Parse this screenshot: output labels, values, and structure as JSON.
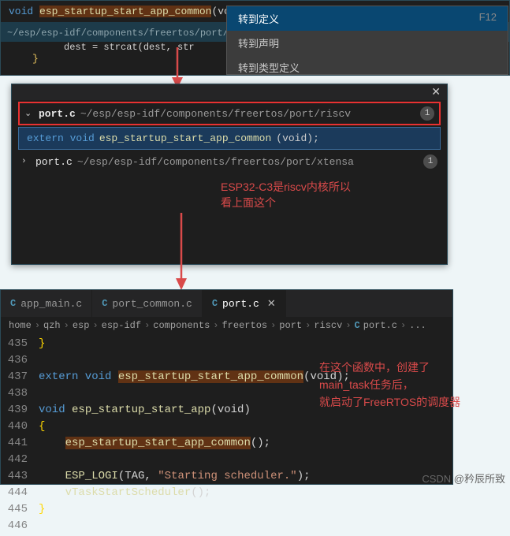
{
  "top": {
    "signature_kw1": "void ",
    "signature_fn": "esp_startup_start_app_common",
    "signature_args": "(void)",
    "breadcrumb_path": "~/esp/esp-idf/components/freertos/port/riscv · 定",
    "dest_line": "dest = strcat(dest, str",
    "brace": "}"
  },
  "context_menu": {
    "items": [
      {
        "label": "转到定义",
        "shortcut": "F12"
      },
      {
        "label": "转到声明",
        "shortcut": ""
      },
      {
        "label": "转到类型定义",
        "shortcut": ""
      }
    ]
  },
  "mid": {
    "file1_name": "port.c",
    "file1_path": "~/esp/esp-idf/components/freertos/port/riscv",
    "file1_badge": "1",
    "decl_kw": "extern void ",
    "decl_fn": "esp_startup_start_app_common",
    "decl_args": "(void);",
    "file2_name": "port.c",
    "file2_path": "~/esp/esp-idf/components/freertos/port/xtensa",
    "file2_badge": "1",
    "annotation_l1": "ESP32-C3是riscv内核所以",
    "annotation_l2": "看上面这个"
  },
  "bottom": {
    "tabs": [
      {
        "icon": "C",
        "label": "app_main.c",
        "active": false
      },
      {
        "icon": "C",
        "label": "port_common.c",
        "active": false
      },
      {
        "icon": "C",
        "label": "port.c",
        "active": true
      }
    ],
    "crumbs": [
      "home",
      "qzh",
      "esp",
      "esp-idf",
      "components",
      "freertos",
      "port",
      "riscv",
      "port.c",
      "..."
    ],
    "crumb_icon": "C",
    "code": {
      "l435": "}",
      "l436": "",
      "l437_kw": "extern void ",
      "l437_fn": "esp_startup_start_app_common",
      "l437_rest": "(void);",
      "l438": "",
      "l439_kw": "void ",
      "l439_fn": "esp_startup_start_app",
      "l439_rest": "(void)",
      "l440": "{",
      "l441_fn": "esp_startup_start_app_common",
      "l441_rest": "();",
      "l442": "",
      "l443_fn": "ESP_LOGI",
      "l443_args1": "(TAG, ",
      "l443_str": "\"Starting scheduler.\"",
      "l443_args2": ");",
      "l444_fn": "vTaskStartScheduler",
      "l444_rest": "();",
      "l445": "}",
      "l446": ""
    },
    "annotation_l1": "在这个函数中，创建了",
    "annotation_l2": "main_task任务后，",
    "annotation_l3": "就启动了FreeRTOS的调度器"
  },
  "watermark": "CSDN @矜辰所致"
}
